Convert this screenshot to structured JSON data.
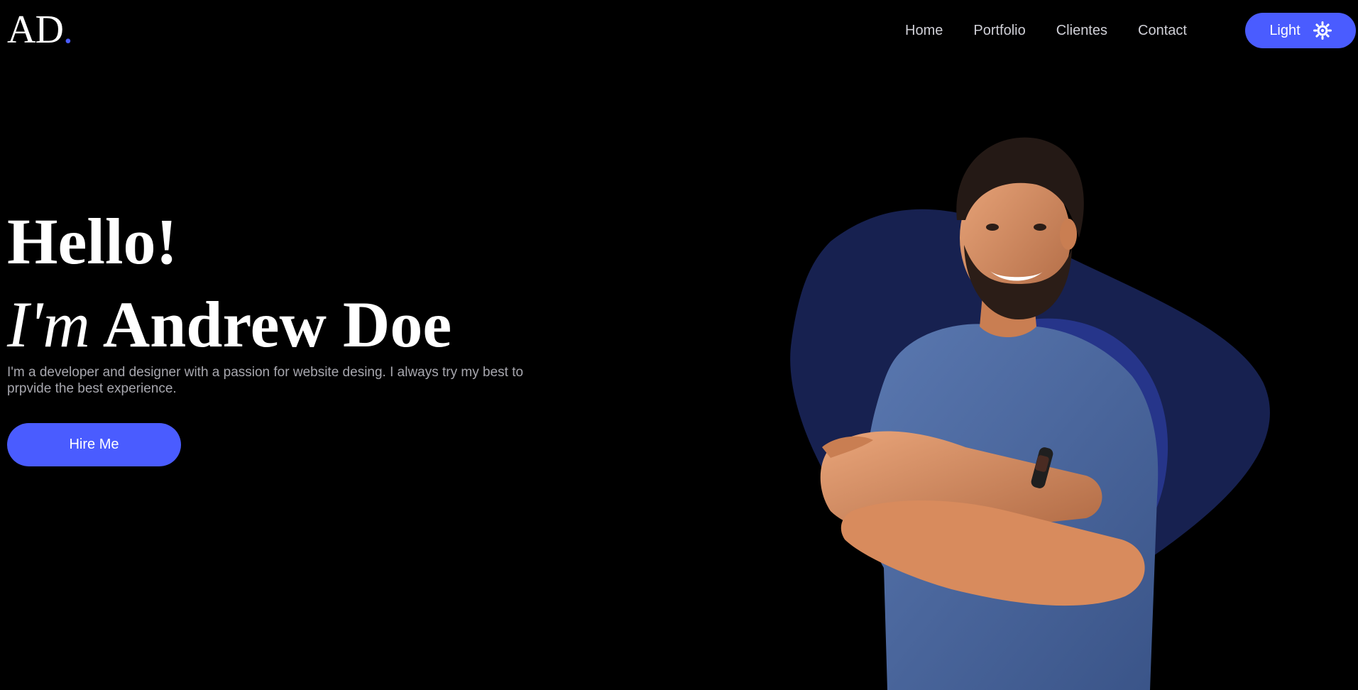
{
  "header": {
    "logo_text": "AD",
    "logo_dot": ".",
    "nav": [
      {
        "label": "Home"
      },
      {
        "label": "Portfolio"
      },
      {
        "label": "Clientes"
      },
      {
        "label": "Contact"
      }
    ],
    "theme_toggle": {
      "label": "Light",
      "icon": "sun-icon"
    }
  },
  "hero": {
    "greeting": "Hello!",
    "im": "I'm",
    "name": "Andrew Doe",
    "description": "I'm a developer and designer with a passion for website desing. I always try my best to prpvide the best experience.",
    "cta_label": "Hire Me"
  },
  "colors": {
    "background": "#000000",
    "accent": "#4a5cff",
    "blob_dark": "#172150",
    "blob_light": "#26358a",
    "text": "#ffffff",
    "muted_text": "#a7a7ae"
  }
}
